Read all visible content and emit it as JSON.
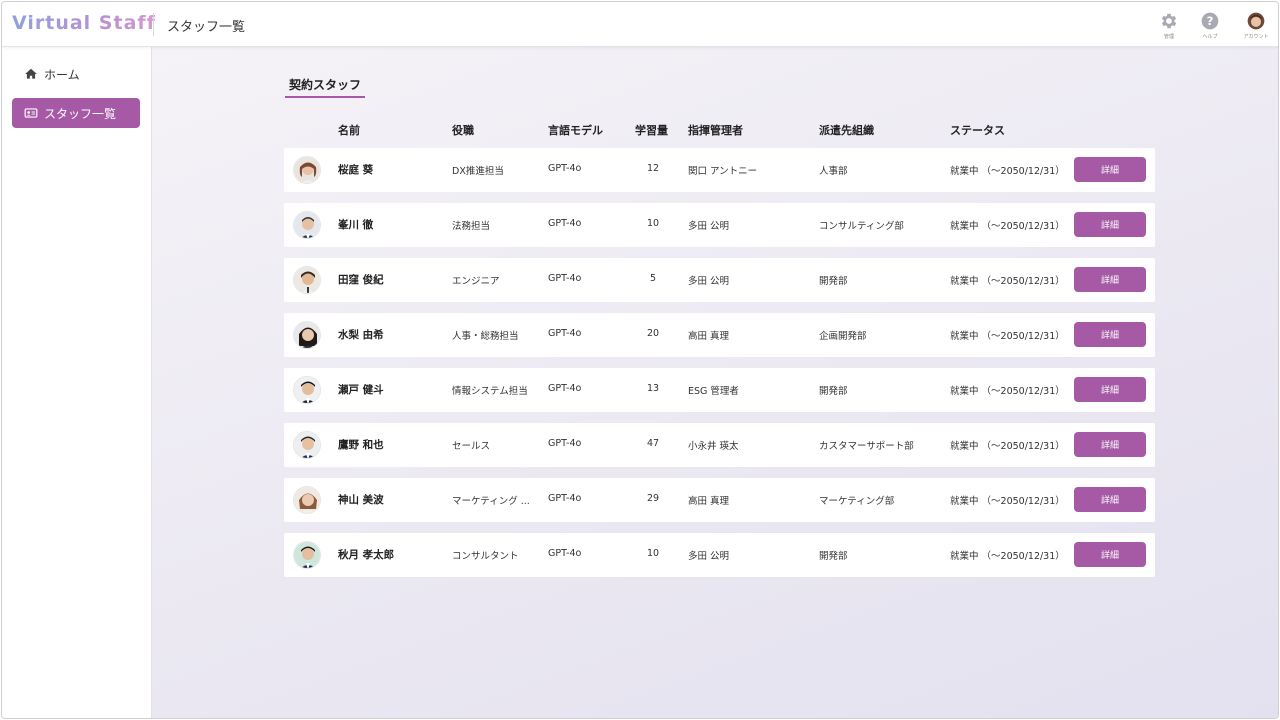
{
  "app": {
    "logo": "Virtual Staff",
    "page_title": "スタッフ一覧"
  },
  "header": {
    "settings_label": "管理",
    "help_label": "ヘルプ",
    "account_label": "アカウント"
  },
  "sidebar": {
    "items": [
      {
        "label": "ホーム",
        "icon": "home-icon"
      },
      {
        "label": "スタッフ一覧",
        "icon": "id-card-icon",
        "active": true
      }
    ]
  },
  "main": {
    "tab": "契約スタッフ",
    "columns": [
      "名前",
      "役職",
      "言語モデル",
      "学習量",
      "指揮管理者",
      "派遣先組織",
      "ステータス"
    ],
    "detail_label": "詳細",
    "rows": [
      {
        "name": "桜庭 葵",
        "role": "DX推進担当",
        "model": "GPT-4o",
        "learning": "12",
        "manager": "関口 アントニー",
        "org": "人事部",
        "status": "就業中 （～2050/12/31）"
      },
      {
        "name": "峯川 徹",
        "role": "法務担当",
        "model": "GPT-4o",
        "learning": "10",
        "manager": "多田 公明",
        "org": "コンサルティング部",
        "status": "就業中 （～2050/12/31）"
      },
      {
        "name": "田窪 俊紀",
        "role": "エンジニア",
        "model": "GPT-4o",
        "learning": "5",
        "manager": "多田 公明",
        "org": "開発部",
        "status": "就業中 （～2050/12/31）"
      },
      {
        "name": "水梨 由希",
        "role": "人事・総務担当",
        "model": "GPT-4o",
        "learning": "20",
        "manager": "高田 真理",
        "org": "企画開発部",
        "status": "就業中 （～2050/12/31）"
      },
      {
        "name": "瀬戸 健斗",
        "role": "情報システム担当",
        "model": "GPT-4o",
        "learning": "13",
        "manager": "ESG 管理者",
        "org": "開発部",
        "status": "就業中 （～2050/12/31）"
      },
      {
        "name": "鷹野 和也",
        "role": "セールス",
        "model": "GPT-4o",
        "learning": "47",
        "manager": "小永井 瑛太",
        "org": "カスタマーサポート部",
        "status": "就業中 （～2050/12/31）"
      },
      {
        "name": "神山 美波",
        "role": "マーケティング ...",
        "model": "GPT-4o",
        "learning": "29",
        "manager": "高田 真理",
        "org": "マーケティング部",
        "status": "就業中 （～2050/12/31）"
      },
      {
        "name": "秋月 孝太郎",
        "role": "コンサルタント",
        "model": "GPT-4o",
        "learning": "10",
        "manager": "多田 公明",
        "org": "開発部",
        "status": "就業中 （～2050/12/31）"
      }
    ]
  },
  "colors": {
    "accent": "#a65aa6",
    "logo_gradient_start": "#8fa3d9",
    "logo_gradient_end": "#d59ad0"
  }
}
